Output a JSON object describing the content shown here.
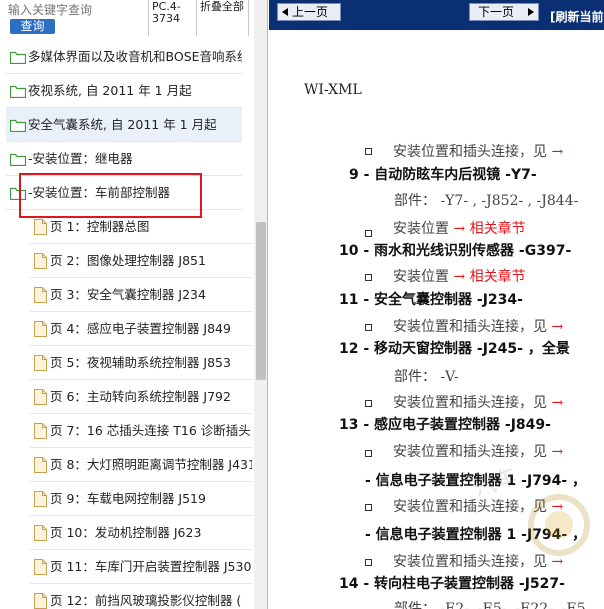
{
  "search": {
    "placeholder": "输入关键字查询",
    "button": "查询"
  },
  "header": {
    "code": "PC.4-3734",
    "collapse": "折叠全部"
  },
  "tree": {
    "folders": [
      {
        "label": "多媒体界面以及收音机和BOSE音响系统"
      },
      {
        "label": "夜视系统, 自 2011 年 1 月起"
      },
      {
        "label": "安全气囊系统, 自 2011 年 1 月起"
      },
      {
        "label": "-安装位置：继电器"
      },
      {
        "label": "-安装位置：车前部控制器"
      }
    ],
    "pages": [
      {
        "label": "页 1：控制器总图"
      },
      {
        "label": "页 2：图像处理控制器 J851"
      },
      {
        "label": "页 3：安全气囊控制器 J234"
      },
      {
        "label": "页 4：感应电子装置控制器 J849"
      },
      {
        "label": "页 5：夜视辅助系统控制器 J853"
      },
      {
        "label": "页 6：主动转向系统控制器 J792"
      },
      {
        "label": "页 7：16 芯插头连接 T16 诊断插头"
      },
      {
        "label": "页 8：大灯照明距离调节控制器 J431"
      },
      {
        "label": "页 9：车载电网控制器 J519"
      },
      {
        "label": "页 10：发动机控制器 J623"
      },
      {
        "label": "页 11：车库门开启装置控制器 J530"
      },
      {
        "label": "页 12：前挡风玻璃投影仪控制器 ("
      }
    ]
  },
  "nav": {
    "prev": "上一页",
    "next": "下一页",
    "refresh": "[刷新当前"
  },
  "doc": {
    "title": "WI-XML",
    "lines": {
      "l1": "安装位置和插头连接，见",
      "l2": "9 - 自动防眩车内后视镜 -Y7-",
      "l3": "部件： -Y7- , -J852- , -J844-",
      "l4": "安装位置",
      "l4_link": "相关章节",
      "l5": "10 - 雨水和光线识别传感器 -G397-",
      "l6": "安装位置",
      "l6_link": "相关章节",
      "l7": "11 - 安全气囊控制器 -J234-",
      "l8": "安装位置和插头连接，见",
      "l9": "12 - 移动天窗控制器 -J245- ，全景",
      "l10": "部件： -V-",
      "l11": "安装位置和插头连接，见",
      "l12": "13 - 感应电子装置控制器 -J849-",
      "l13": "安装位置和插头连接，见",
      "l14": "- 信息电子装置控制器 1 -J794- ，",
      "l15": "安装位置和插头连接，见",
      "l16": "- 信息电子装置控制器 1 -J794- ，",
      "l17": "安装位置和插头连接，见",
      "l18": "14 - 转向柱电子装置控制器 -J527-",
      "l19": "部件： -E2- ,-E5- ,-E22- ,-E5",
      "arrow": "→"
    }
  },
  "colors": {
    "nav_bg": "#0b2f73",
    "link_red": "#e0161b",
    "search_btn": "#2b6fc2",
    "folder_green": "#3a9c3a"
  }
}
